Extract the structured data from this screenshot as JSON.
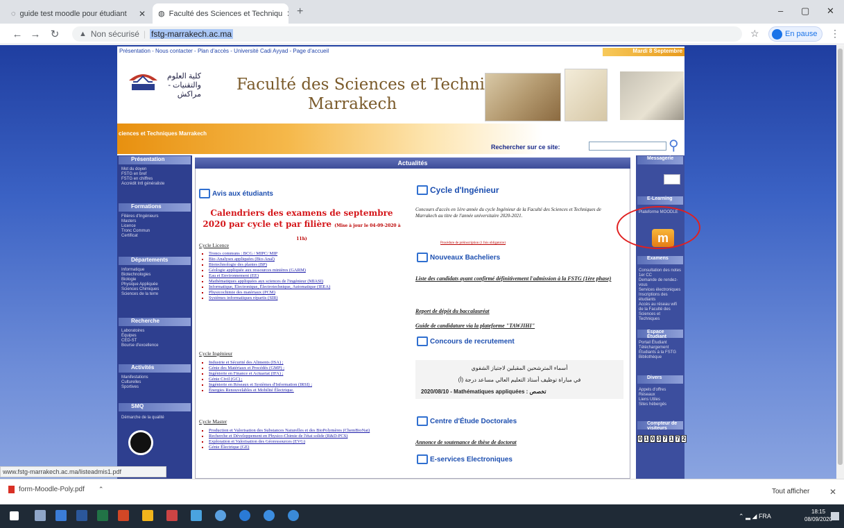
{
  "browser": {
    "tabs": [
      {
        "label": "guide test moodle pour étudiant"
      },
      {
        "label": "Faculté des Sciences et Techniqu"
      }
    ],
    "new_tab": "+",
    "not_secure": "Non sécurisé",
    "url": "fstg-marrakech.ac.ma",
    "profile": "En pause",
    "window_controls": {
      "minimize": "–",
      "maximize": "▢",
      "close": "✕"
    }
  },
  "site": {
    "topnav": "Présentation  -  Nous contacter  -  Plan d'accès  -  Université Cadi Ayyad  -  Page d'accueil",
    "date": "Mardi 8 Septembre",
    "arabic_name": "كلية العلوم والتقنيات - مراكش",
    "title_line1": "Faculté des Sciences et Techniques",
    "title_line2": "Marrakech",
    "banner_text": "ciences et Techniques Marrakech",
    "search_label": "Rechercher sur ce site:",
    "left_sections": [
      {
        "title": "Présentation",
        "items": "Mot du doyen\nFSTG en bref\nFSTG en chiffres\nAccrédit Intl généraliste"
      },
      {
        "title": "Formations",
        "items": "Filières d'Ingénieurs\nMasters\nLicence\nTronc Commun\nCertificat"
      },
      {
        "title": "Départements",
        "items": "Informatique\nBiotechnologies\nBiologie\nPhysique Appliquée\nSciences Chimiques\nSciences de la terre"
      },
      {
        "title": "Recherche",
        "items": "Laboratoires\nÉquipes\nCED-ST\nBourse d'excellence"
      },
      {
        "title": "Activités",
        "items": "Manifestations\nCulturelles\nSportives"
      },
      {
        "title": "SMQ",
        "items": "Démarche de la qualité"
      }
    ],
    "center_header": "Actualités",
    "avis_title": "Avis aux étudiants",
    "calendar_title": "Calendriers des examens de septembre 2020 par cycle et par filière",
    "calendar_note": "(Mise à jour le 04-09-2020 à 11h)",
    "cycle_licence": "Cycle Licence",
    "licence_items": [
      "Troncs communs : BCG / MIPC/ MIP",
      "Bio-Analyses appliquées (Bio-Anal)",
      "Biotechnologie des plantes (BP)",
      "Géologie appliquée aux ressources minières (GARM)",
      "Eau et Environnement (EE)",
      "Mathématiques appliquées aux sciences de l'ingénieur (MIASI)",
      "Informatique, Électronique, Électrotechnique, Automatique (IEEA)",
      "Physicochimie des matériaux (PCM)",
      "Systèmes informatiques répartis (SIR)"
    ],
    "cycle_ingenieur": "Cycle Ingénieur",
    "ingenieur_items": [
      "Industrie et Sécurité des Aliments (ISA) ;",
      "Génie des Matériaux et Procédés (GMP) ;",
      "Ingénierie en Finance et Actuariat (IFA) ;",
      "Génie Civil (GC) ;",
      "Ingénierie en Réseaux et Systèmes d'Information (IRSI) ;",
      "Énergies Renouvelables et Mobilité Électrique."
    ],
    "cycle_master": "Cycle Master",
    "master_items": [
      "Production et Valorisation des Substances Naturelles et des BioPolymères (ChemBioNat)",
      "Recherche et Développement en Physico-Chimie de l'état solide (R&D-PCS)",
      "Exploration et Valorisation des Géoressources (EVG)",
      "Génie Électrique (GE)"
    ],
    "cycle_ing_title": "Cycle d'Ingénieur",
    "cycle_ing_text": "Concours d'accès en 1ère année du cycle Ingénieur de la Faculté des Sciences et Techniques de Marrakech au titre de l'année universitaire 2020-2021.",
    "cycle_ing_link": "Procédure de préinscription (1 fois obligatoire)",
    "nb_title": "Nouveaux Bacheliers",
    "nb_item1": "Liste des candidats ayant confirmé définitivement l'admission à la FSTG (1ère phase)",
    "nb_item2": "Report de dépôt du baccalauréat",
    "nb_item3": "Guide de candidature via la plateforme \"TAWJIHI\"",
    "concours_title": "Concours de recrutement",
    "concours_ar1": "أسماء المترشحين المقبلين لاجتياز الشفوي",
    "concours_ar2": "في مباراة توظيف أستاذ التعليم العالي مساعد درجة (أ)",
    "concours_line": "2020/08/10 - Mathématiques appliquées : تخصص",
    "ced_title": "Centre d'Étude Doctorales",
    "ced_item": "Annonce de soutenance de thèse de doctorat",
    "eserv_title": "E-services Electroniques",
    "right_sections": [
      {
        "title": "Messagerie",
        "items": ""
      },
      {
        "title": "E-Learning",
        "items": "Plateforme MOODLE"
      },
      {
        "title": "Examens",
        "items": "Consultation des notes 1er CC\nDemande de rendez-vous\nServices électroniques\nInscriptions des étudiants\nAccès au réseau wifi de la Faculté des Sciences et Techniques"
      },
      {
        "title": "Espace Étudiant",
        "items": "Portail Étudiant\nTéléchargement\nÉtudiants à la FSTG\nBibliothèque"
      },
      {
        "title": "Divers",
        "items": "Appels d'offres\nRéseaux\nLiens Utiles\nSites hébergés"
      },
      {
        "title": "Compteur de visiteurs",
        "items": ""
      }
    ],
    "counter": [
      "0",
      "1",
      "0",
      "3",
      "7",
      "1",
      "7",
      "2"
    ],
    "moodle_letter": "m"
  },
  "statusbar": "www.fstg-marrakech.ac.ma/listeadmis1.pdf",
  "downloads": {
    "file": "form-Moodle-Poly.pdf",
    "show_all": "Tout afficher",
    "close": "✕"
  },
  "taskbar": {
    "time": "18:15",
    "date": "08/09/2020",
    "lang": "FRA"
  },
  "colors": {
    "accent": "#1a73e8",
    "site_orange": "#e8900f",
    "site_blue": "#2e3f8f",
    "headline_red": "#d4161a",
    "annotation_red": "#e02020"
  }
}
